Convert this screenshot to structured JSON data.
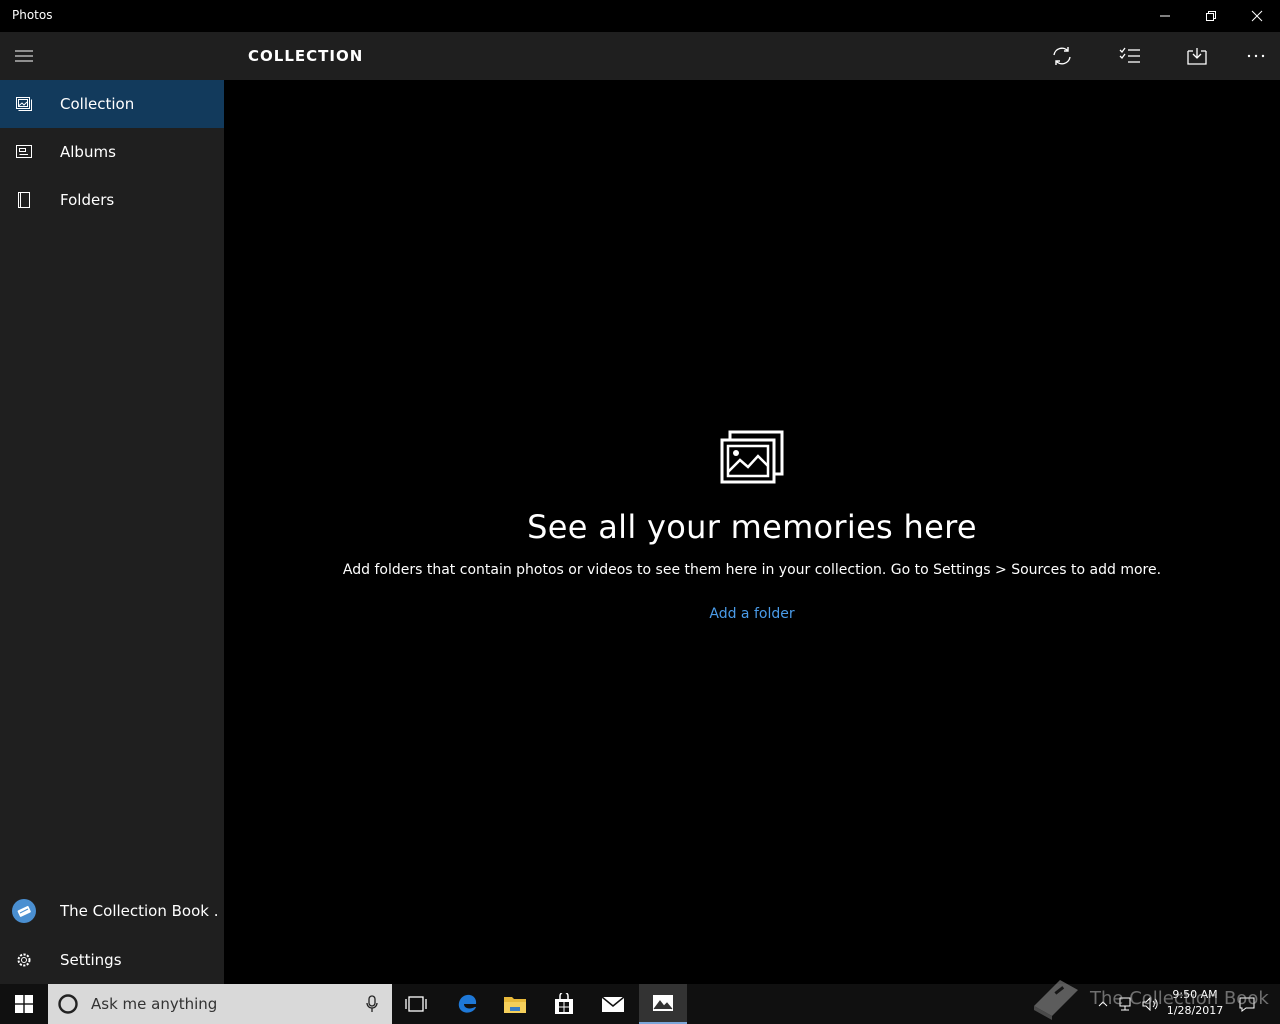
{
  "window": {
    "title": "Photos"
  },
  "nav": {
    "items": [
      {
        "label": "Collection",
        "icon": "collection-icon",
        "active": true
      },
      {
        "label": "Albums",
        "icon": "album-icon",
        "active": false
      },
      {
        "label": "Folders",
        "icon": "folder-icon",
        "active": false
      }
    ],
    "account": {
      "label": "The Collection Book .",
      "icon": "account-icon"
    },
    "settings": {
      "label": "Settings",
      "icon": "gear-icon"
    }
  },
  "header": {
    "title": "COLLECTION",
    "actions": [
      "refresh-icon",
      "select-icon",
      "import-icon",
      "more-icon"
    ]
  },
  "empty_state": {
    "icon": "photos-stack-icon",
    "heading": "See all your memories here",
    "message": "Add folders that contain photos or videos to see them here in your collection. Go to Settings > Sources to add more.",
    "link": "Add a folder"
  },
  "taskbar": {
    "search_placeholder": "Ask me anything",
    "clock_time": "9:50 AM",
    "clock_date": "1/28/2017",
    "watermark": "The Collection Book"
  },
  "colors": {
    "accent": "#123a5c",
    "link": "#4a9be8",
    "chrome": "#1f1f1f"
  }
}
